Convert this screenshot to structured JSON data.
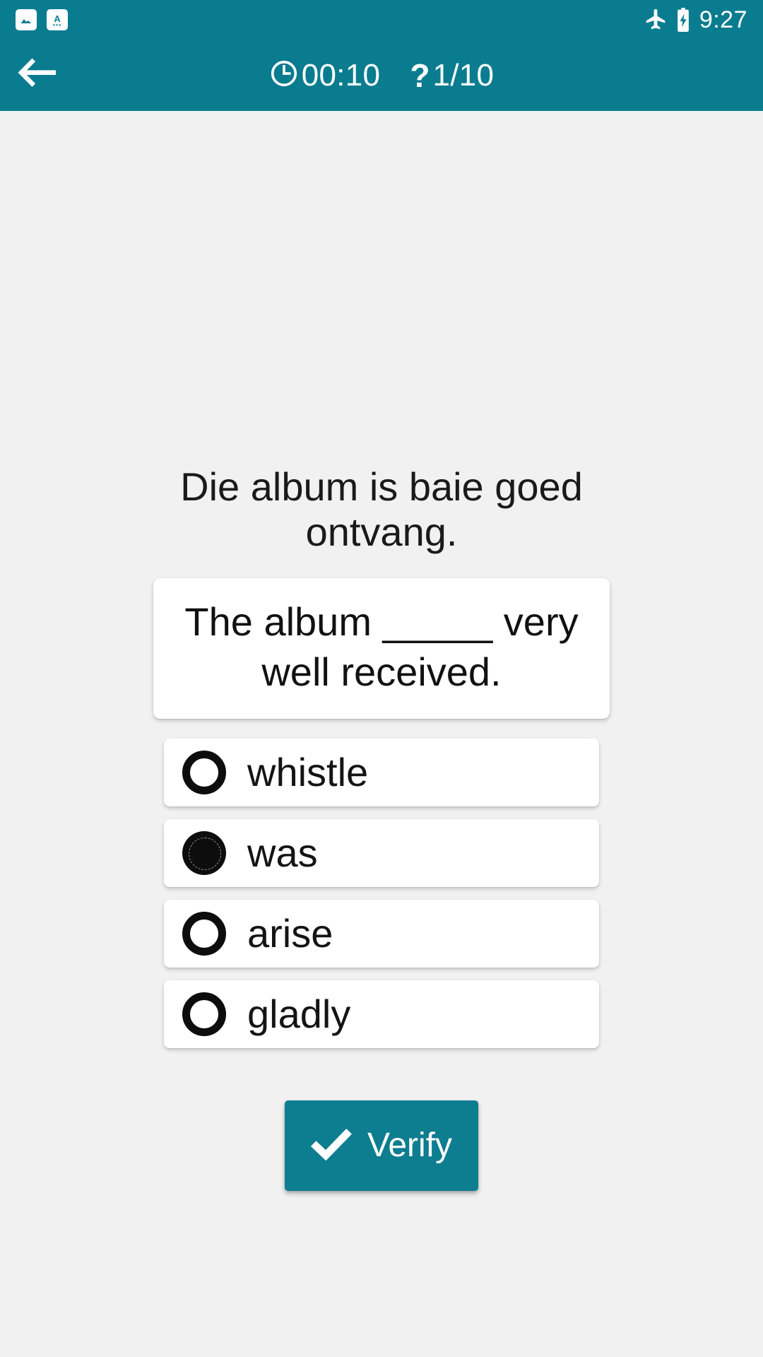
{
  "theme": {
    "accent": "#0a7c8f",
    "button": "#0d7d90",
    "page_background": "#f1f1f1",
    "card_background": "#ffffff",
    "text": "#141414"
  },
  "status_bar": {
    "notifications": [
      {
        "icon": "image-notification-icon"
      },
      {
        "icon": "translate-notification-icon"
      }
    ],
    "system": [
      {
        "icon": "airplane-mode-icon"
      },
      {
        "icon": "battery-charging-icon"
      }
    ],
    "clock": "9:27"
  },
  "app_bar": {
    "back_icon": "back-arrow-icon",
    "timer_icon": "clock-icon",
    "timer": "00:10",
    "question_icon": "question-mark-icon",
    "question_counter": "1/10"
  },
  "quiz": {
    "prompt": "Die album is baie goed ontvang.",
    "question": "The album _____ very well received.",
    "options": [
      {
        "label": "whistle",
        "selected": false
      },
      {
        "label": "was",
        "selected": true
      },
      {
        "label": "arise",
        "selected": false
      },
      {
        "label": "gladly",
        "selected": false
      }
    ],
    "verify_label": "Verify",
    "verify_icon": "check-icon"
  }
}
